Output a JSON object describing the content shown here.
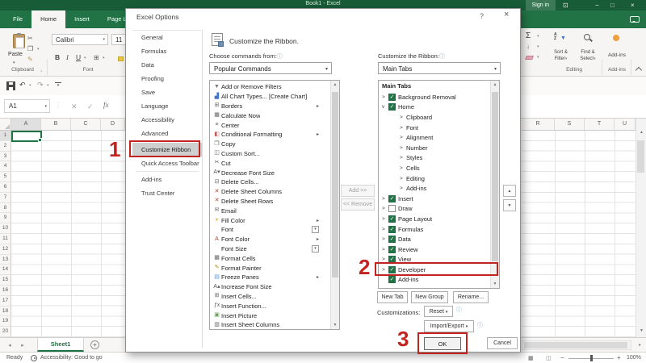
{
  "titlebar": {
    "title": "Book1 - Excel",
    "sign_in": "Sign in"
  },
  "ribbon_tabs": {
    "items": [
      "File",
      "Home",
      "Insert",
      "Page Layout"
    ],
    "active": "Home"
  },
  "ribbon": {
    "paste_label": "Paste",
    "clipboard_group": "Clipboard",
    "font_name": "Calibri",
    "font_size": "11",
    "bold": "B",
    "italic": "I",
    "underline": "U",
    "font_group": "Font",
    "sort_line1": "Sort &",
    "sort_line2": "Filter",
    "find_line1": "Find &",
    "find_line2": "Select",
    "editing_group": "Editing",
    "addins_button": "Add-ins",
    "addins_group": "Add-ins"
  },
  "formula_bar": {
    "name_box": "A1",
    "fx_label": "fx"
  },
  "sheet": {
    "left_columns": [
      "A",
      "B",
      "C",
      "D"
    ],
    "right_columns": [
      "R",
      "S",
      "T",
      "U"
    ],
    "row_numbers": [
      1,
      2,
      3,
      4,
      5,
      6,
      7,
      8,
      9,
      10,
      11,
      12,
      13,
      14,
      15,
      16,
      17,
      18,
      19,
      20
    ],
    "active_cell": "A1",
    "sheet_tab": "Sheet1"
  },
  "status_bar": {
    "ready": "Ready",
    "accessibility": "Accessibility: Good to go",
    "zoom_level": "100%"
  },
  "dialog": {
    "title": "Excel Options",
    "nav": [
      {
        "label": "General"
      },
      {
        "label": "Formulas"
      },
      {
        "label": "Data"
      },
      {
        "label": "Proofing"
      },
      {
        "label": "Save"
      },
      {
        "label": "Language"
      },
      {
        "label": "Accessibility"
      },
      {
        "label": "Advanced"
      },
      {
        "sep": true
      },
      {
        "label": "Customize Ribbon",
        "active": true
      },
      {
        "label": "Quick Access Toolbar"
      },
      {
        "sep": true
      },
      {
        "label": "Add-ins"
      },
      {
        "label": "Trust Center"
      }
    ],
    "header_text": "Customize the Ribbon.",
    "choose_commands_label": "Choose commands from:",
    "choose_commands_value": "Popular Commands",
    "customize_ribbon_label": "Customize the Ribbon:",
    "customize_ribbon_value": "Main Tabs",
    "commands": [
      {
        "icon": "funnel",
        "c": "#777777",
        "label": "Add or Remove Filters"
      },
      {
        "icon": "chart",
        "c": "#4472c4",
        "label": "All Chart Types... [Create Chart]"
      },
      {
        "icon": "borders",
        "c": "#666666",
        "label": "Borders",
        "trail": "menu"
      },
      {
        "icon": "calculate",
        "c": "#666666",
        "label": "Calculate Now"
      },
      {
        "icon": "align-center",
        "c": "#666666",
        "label": "Center"
      },
      {
        "icon": "conditional-formatting",
        "c": "#c55a5a",
        "label": "Conditional Formatting",
        "trail": "menu"
      },
      {
        "icon": "copy",
        "c": "#666666",
        "label": "Copy"
      },
      {
        "icon": "custom-sort",
        "c": "#666666",
        "label": "Custom Sort..."
      },
      {
        "icon": "cut",
        "c": "#555555",
        "label": "Cut"
      },
      {
        "icon": "font-decrease",
        "c": "#555555",
        "label": "Decrease Font Size"
      },
      {
        "icon": "delete-cells",
        "c": "#666666",
        "label": "Delete Cells..."
      },
      {
        "icon": "delete-red",
        "c": "#c0392b",
        "label": "Delete Sheet Columns"
      },
      {
        "icon": "delete-red",
        "c": "#c0392b",
        "label": "Delete Sheet Rows"
      },
      {
        "icon": "email",
        "c": "#666666",
        "label": "Email"
      },
      {
        "icon": "fill-color",
        "c": "#e8c94a",
        "label": "Fill Color",
        "trail": "menu"
      },
      {
        "icon": "none",
        "c": "#666666",
        "label": "Font",
        "trail": "drop"
      },
      {
        "icon": "font-color",
        "c": "#c0392b",
        "label": "Font Color",
        "trail": "menu"
      },
      {
        "icon": "none",
        "c": "#666666",
        "label": "Font Size",
        "trail": "drop"
      },
      {
        "icon": "format-cells",
        "c": "#666666",
        "label": "Format Cells"
      },
      {
        "icon": "format-painter",
        "c": "#b8860b",
        "label": "Format Painter"
      },
      {
        "icon": "freeze",
        "c": "#5b9bd5",
        "label": "Freeze Panes",
        "trail": "menu"
      },
      {
        "icon": "font-increase",
        "c": "#555555",
        "label": "Increase Font Size"
      },
      {
        "icon": "insert-cells",
        "c": "#666666",
        "label": "Insert Cells..."
      },
      {
        "icon": "insert-function",
        "c": "#555555",
        "label": "Insert Function..."
      },
      {
        "icon": "insert-picture",
        "c": "#6a9f58",
        "label": "Insert Picture"
      },
      {
        "icon": "insert-columns",
        "c": "#666666",
        "label": "Insert Sheet Columns"
      }
    ],
    "add_button": "Add >>",
    "remove_button": "<< Remove",
    "tabs_list_header": "Main Tabs",
    "main_tabs": [
      {
        "expand": "collapsed",
        "check": true,
        "label": "Background Removal"
      },
      {
        "expand": "expanded",
        "check": true,
        "label": "Home"
      },
      {
        "indent": true,
        "expand": "collapsed",
        "label": "Clipboard"
      },
      {
        "indent": true,
        "expand": "collapsed",
        "label": "Font"
      },
      {
        "indent": true,
        "expand": "collapsed",
        "label": "Alignment"
      },
      {
        "indent": true,
        "expand": "collapsed",
        "label": "Number"
      },
      {
        "indent": true,
        "expand": "collapsed",
        "label": "Styles"
      },
      {
        "indent": true,
        "expand": "collapsed",
        "label": "Cells"
      },
      {
        "indent": true,
        "expand": "collapsed",
        "label": "Editing"
      },
      {
        "indent": true,
        "expand": "collapsed",
        "label": "Add-ins"
      },
      {
        "expand": "collapsed",
        "check": true,
        "label": "Insert"
      },
      {
        "expand": "collapsed",
        "check": false,
        "label": "Draw"
      },
      {
        "expand": "collapsed",
        "check": true,
        "label": "Page Layout"
      },
      {
        "expand": "collapsed",
        "check": true,
        "label": "Formulas"
      },
      {
        "expand": "collapsed",
        "check": true,
        "label": "Data"
      },
      {
        "expand": "collapsed",
        "check": true,
        "label": "Review"
      },
      {
        "expand": "collapsed",
        "check": true,
        "label": "View"
      },
      {
        "expand": "collapsed",
        "check": true,
        "label": "Developer",
        "highlighted": true
      },
      {
        "check": true,
        "label": "Add-ins"
      }
    ],
    "new_tab": "New Tab",
    "new_group": "New Group",
    "rename": "Rename...",
    "customizations_label": "Customizations:",
    "reset_button": "Reset",
    "import_export_button": "Import/Export",
    "ok_button": "OK",
    "cancel_button": "Cancel"
  },
  "annotations": {
    "step_1": "1",
    "step_2": "2",
    "step_3": "3",
    "color": "#c32320"
  },
  "icons": {
    "funnel": "▼",
    "chart": "▟",
    "borders": "⊞",
    "calculate": "▦",
    "align-center": "≡",
    "conditional-formatting": "◧",
    "copy": "❐",
    "custom-sort": "◫",
    "cut": "✂",
    "font-decrease": "A▾",
    "delete-cells": "⊟",
    "delete-red": "✕",
    "email": "✉",
    "fill-color": "●",
    "font-color": "A",
    "format-cells": "▦",
    "format-painter": "✎",
    "freeze": "▤",
    "font-increase": "A▴",
    "insert-cells": "⊞",
    "insert-function": "ƒx",
    "insert-picture": "▣",
    "insert-columns": "▥",
    "none": "",
    "dropdown": "▾",
    "menu-arrow": "▸",
    "autosum": "Σ",
    "fill-down": "↓",
    "undo": "↶",
    "redo": "↷",
    "check": "✓",
    "expand-collapsed": ">",
    "expand-expanded": "v",
    "info": "ⓘ",
    "up": "▲",
    "down": "▼",
    "left": "◂",
    "right": "▸",
    "plus": "+",
    "minus": "−",
    "x-cancel": "✕",
    "multiply": "✕",
    "check-gray": "✓",
    "help": "?",
    "close": "×",
    "minimize": "−",
    "maximize": "□",
    "restore": "⊡",
    "view-normal": "▦",
    "view-page": "◫",
    "dots": "⋮",
    "launcher": "⌟"
  }
}
